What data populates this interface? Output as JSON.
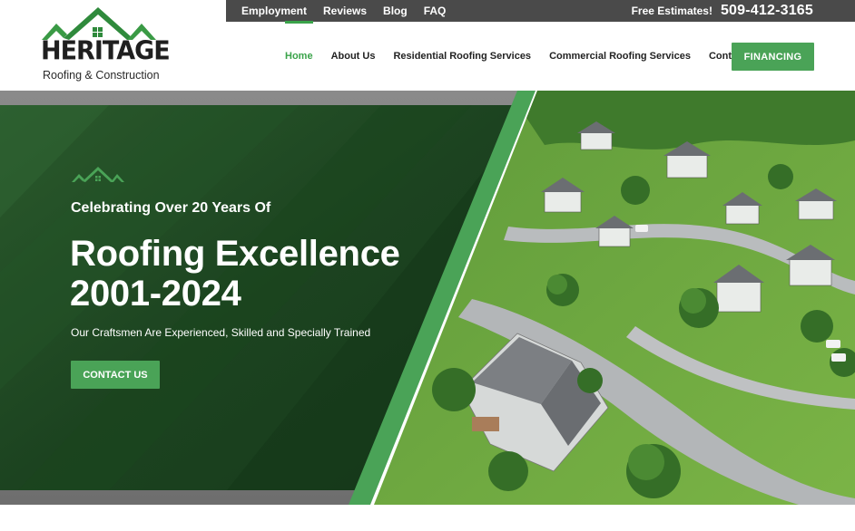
{
  "topbar": {
    "links": [
      "Employment",
      "Reviews",
      "Blog",
      "FAQ"
    ],
    "estimate_label": "Free Estimates!",
    "phone": "509-412-3165"
  },
  "logo": {
    "name": "HERITAGE",
    "subtitle": "Roofing & Construction"
  },
  "nav": {
    "items": [
      "Home",
      "About Us",
      "Residential Roofing Services",
      "Commercial Roofing Services",
      "Contact Us"
    ],
    "active": "Home",
    "financing_label": "FINANCING"
  },
  "hero": {
    "eyebrow": "Celebrating Over 20 Years Of",
    "headline_line1": "Roofing Excellence",
    "headline_line2": "2001-2024",
    "tagline": "Our Craftsmen Are Experienced, Skilled and Specially Trained",
    "cta_label": "CONTACT US",
    "background_image": "aerial-neighborhood-photo"
  },
  "colors": {
    "brand_green": "#4aa357",
    "dark_green": "#1f4d25",
    "topbar_gray": "#4a4a4a"
  }
}
